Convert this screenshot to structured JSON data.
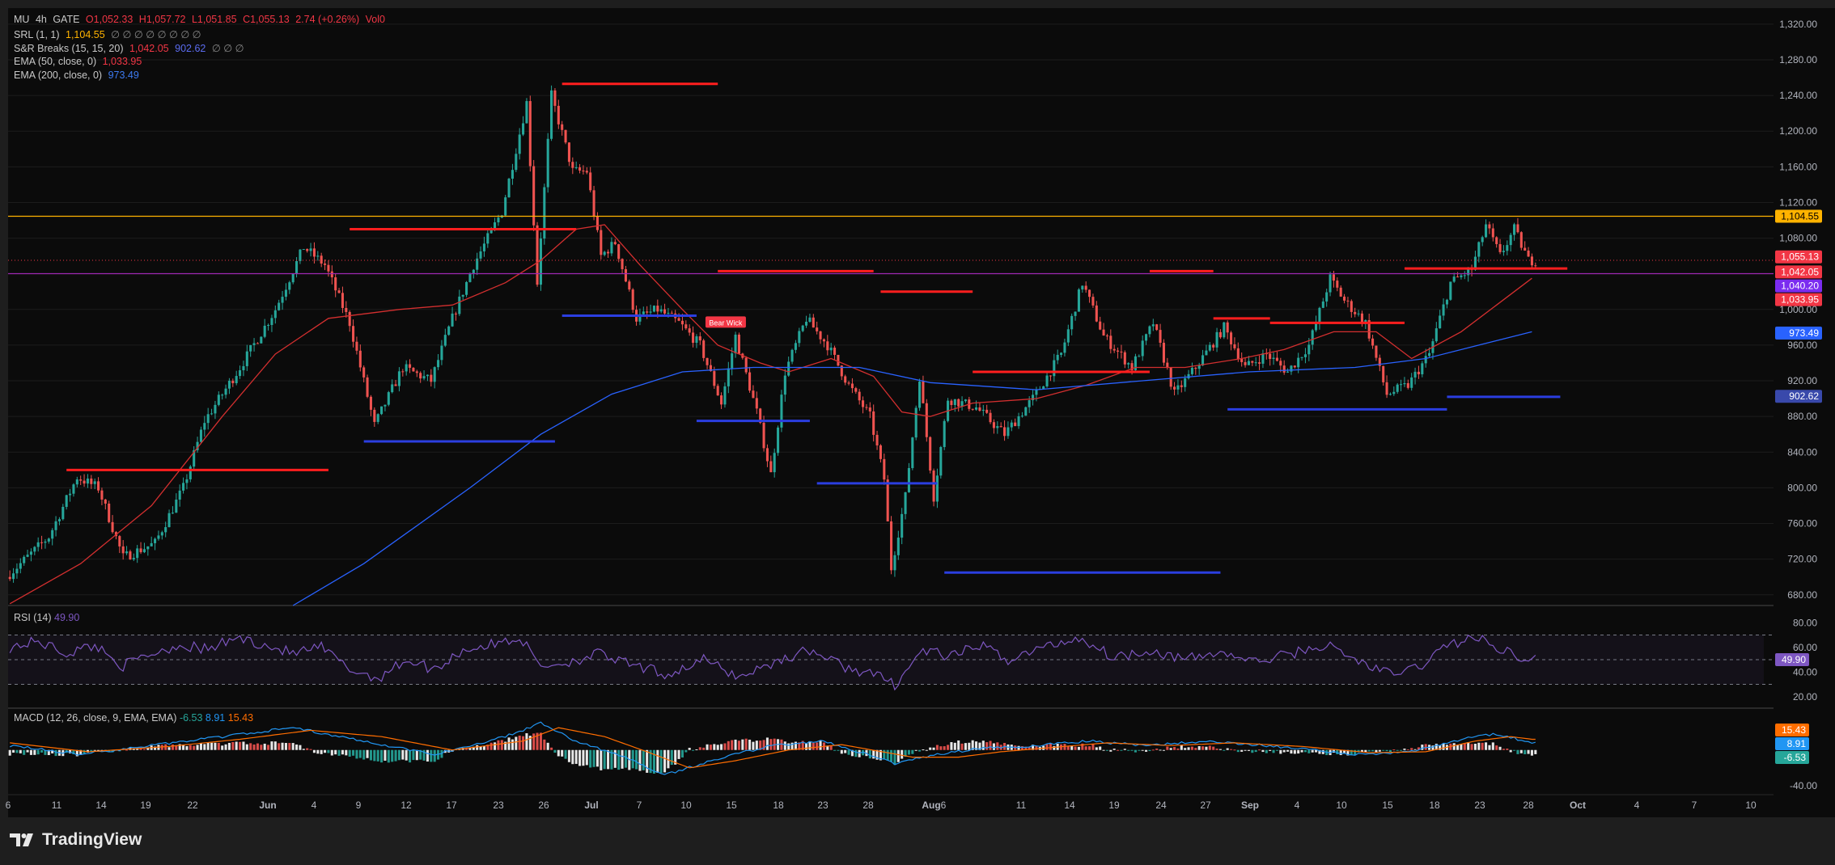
{
  "header": {
    "symbol": "MU",
    "interval": "4h",
    "exchange": "GATE",
    "open": "O1,052.33",
    "high": "H1,057.72",
    "low": "L1,051.85",
    "close": "C1,055.13",
    "change": "2.74 (+0.26%)",
    "volume": "Vol0"
  },
  "indicators": [
    {
      "name": "SRL (1, 1)",
      "v1": "1,104.55",
      "c1": "#ffb300",
      "v2": "",
      "c2": "",
      "v3": "1,040.20",
      "c3": "#b388ff",
      "tail": "∅ ∅ ∅ ∅ ∅ ∅ ∅ ∅"
    },
    {
      "name": "S&R Breaks (15, 15, 20)",
      "v1": "1,042.05",
      "c1": "#f23645",
      "v2": "",
      "c2": "",
      "v3": "902.62",
      "c3": "#5b6cf0",
      "tail": "∅ ∅ ∅"
    },
    {
      "name": "EMA (50, close, 0)",
      "v1": "1,033.95",
      "c1": "#f23645",
      "v2": "",
      "c2": "",
      "v3": "",
      "c3": "",
      "tail": ""
    },
    {
      "name": "EMA (200, close, 0)",
      "v1": "973.49",
      "c1": "#3d7af0",
      "v2": "",
      "c2": "",
      "v3": "",
      "c3": "",
      "tail": ""
    }
  ],
  "rsi_label": {
    "name": "RSI (14)",
    "value": "49.90"
  },
  "macd_label": {
    "name": "MACD (12, 26, close, 9, EMA, EMA)",
    "v1": "-6.53",
    "v2": "8.91",
    "v3": "15.43"
  },
  "brand": "TradingView",
  "colors": {
    "bull": "#26a69a",
    "bear": "#ef5350",
    "srl": "#ffb300",
    "resistance": "#ff1e1e",
    "support": "#2b3ee0",
    "ema50": "#d32f2f",
    "ema200": "#2962ff",
    "rsi": "#7e57c2",
    "macd": "#2196f3",
    "signal": "#ff6d00"
  },
  "chart_data": {
    "type": "candlestick",
    "price_axis_ticks": [
      "1,320.00",
      "1,280.00",
      "1,240.00",
      "1,200.00",
      "1,160.00",
      "1,120.00",
      "1,080.00",
      "1,040.00",
      "1,000.00",
      "960.00",
      "920.00",
      "880.00",
      "840.00",
      "800.00",
      "760.00",
      "720.00",
      "680.00"
    ],
    "ylim": [
      668,
      1338
    ],
    "time_axis_ticks": [
      "6",
      "11",
      "14",
      "19",
      "22",
      "Jun",
      "4",
      "9",
      "12",
      "17",
      "23",
      "26",
      "Jul",
      "7",
      "10",
      "15",
      "18",
      "23",
      "28",
      "Aug",
      "6",
      "11",
      "14",
      "19",
      "24",
      "27",
      "Sep",
      "4",
      "10",
      "15",
      "18",
      "23",
      "28",
      "Oct",
      "4",
      "7",
      "10"
    ],
    "bold_time_ticks": [
      "Jun",
      "Jul",
      "Aug",
      "Sep",
      "Oct"
    ],
    "trend_anchors": [
      {
        "i": 0,
        "p": 700
      },
      {
        "i": 12,
        "p": 745
      },
      {
        "i": 20,
        "p": 812
      },
      {
        "i": 26,
        "p": 800
      },
      {
        "i": 33,
        "p": 722
      },
      {
        "i": 42,
        "p": 738
      },
      {
        "i": 50,
        "p": 800
      },
      {
        "i": 56,
        "p": 875
      },
      {
        "i": 66,
        "p": 935
      },
      {
        "i": 76,
        "p": 1000
      },
      {
        "i": 84,
        "p": 1070
      },
      {
        "i": 90,
        "p": 1050
      },
      {
        "i": 97,
        "p": 985
      },
      {
        "i": 104,
        "p": 870
      },
      {
        "i": 112,
        "p": 935
      },
      {
        "i": 120,
        "p": 920
      },
      {
        "i": 126,
        "p": 990
      },
      {
        "i": 132,
        "p": 1050
      },
      {
        "i": 140,
        "p": 1110
      },
      {
        "i": 144,
        "p": 1180
      },
      {
        "i": 147,
        "p": 1232
      },
      {
        "i": 150,
        "p": 1030
      },
      {
        "i": 154,
        "p": 1240
      },
      {
        "i": 160,
        "p": 1155
      },
      {
        "i": 164,
        "p": 1155
      },
      {
        "i": 168,
        "p": 1060
      },
      {
        "i": 172,
        "p": 1075
      },
      {
        "i": 178,
        "p": 990
      },
      {
        "i": 184,
        "p": 1000
      },
      {
        "i": 190,
        "p": 985
      },
      {
        "i": 196,
        "p": 960
      },
      {
        "i": 202,
        "p": 895
      },
      {
        "i": 206,
        "p": 970
      },
      {
        "i": 212,
        "p": 885
      },
      {
        "i": 216,
        "p": 815
      },
      {
        "i": 220,
        "p": 930
      },
      {
        "i": 226,
        "p": 990
      },
      {
        "i": 232,
        "p": 960
      },
      {
        "i": 238,
        "p": 915
      },
      {
        "i": 244,
        "p": 880
      },
      {
        "i": 248,
        "p": 810
      },
      {
        "i": 250,
        "p": 710
      },
      {
        "i": 254,
        "p": 790
      },
      {
        "i": 258,
        "p": 925
      },
      {
        "i": 262,
        "p": 790
      },
      {
        "i": 266,
        "p": 900
      },
      {
        "i": 274,
        "p": 890
      },
      {
        "i": 282,
        "p": 860
      },
      {
        "i": 290,
        "p": 900
      },
      {
        "i": 298,
        "p": 950
      },
      {
        "i": 304,
        "p": 1030
      },
      {
        "i": 310,
        "p": 970
      },
      {
        "i": 318,
        "p": 935
      },
      {
        "i": 324,
        "p": 985
      },
      {
        "i": 330,
        "p": 905
      },
      {
        "i": 336,
        "p": 935
      },
      {
        "i": 344,
        "p": 980
      },
      {
        "i": 350,
        "p": 935
      },
      {
        "i": 356,
        "p": 950
      },
      {
        "i": 362,
        "p": 930
      },
      {
        "i": 368,
        "p": 960
      },
      {
        "i": 374,
        "p": 1035
      },
      {
        "i": 378,
        "p": 1010
      },
      {
        "i": 384,
        "p": 985
      },
      {
        "i": 390,
        "p": 905
      },
      {
        "i": 396,
        "p": 915
      },
      {
        "i": 402,
        "p": 950
      },
      {
        "i": 408,
        "p": 1030
      },
      {
        "i": 414,
        "p": 1045
      },
      {
        "i": 418,
        "p": 1095
      },
      {
        "i": 422,
        "p": 1060
      },
      {
        "i": 426,
        "p": 1090
      },
      {
        "i": 430,
        "p": 1055
      }
    ],
    "ema50_points": [
      [
        0,
        670
      ],
      [
        20,
        715
      ],
      [
        40,
        780
      ],
      [
        60,
        880
      ],
      [
        75,
        950
      ],
      [
        90,
        990
      ],
      [
        110,
        1000
      ],
      [
        125,
        1005
      ],
      [
        140,
        1030
      ],
      [
        150,
        1055
      ],
      [
        160,
        1090
      ],
      [
        168,
        1095
      ],
      [
        178,
        1050
      ],
      [
        190,
        1000
      ],
      [
        200,
        960
      ],
      [
        212,
        940
      ],
      [
        220,
        930
      ],
      [
        232,
        945
      ],
      [
        244,
        925
      ],
      [
        252,
        885
      ],
      [
        260,
        880
      ],
      [
        272,
        895
      ],
      [
        290,
        900
      ],
      [
        304,
        915
      ],
      [
        318,
        935
      ],
      [
        332,
        935
      ],
      [
        348,
        945
      ],
      [
        360,
        955
      ],
      [
        374,
        975
      ],
      [
        386,
        975
      ],
      [
        396,
        945
      ],
      [
        410,
        975
      ],
      [
        420,
        1005
      ],
      [
        430,
        1035
      ]
    ],
    "ema200_points": [
      [
        80,
        668
      ],
      [
        100,
        715
      ],
      [
        130,
        800
      ],
      [
        150,
        860
      ],
      [
        170,
        905
      ],
      [
        190,
        930
      ],
      [
        210,
        935
      ],
      [
        240,
        935
      ],
      [
        260,
        918
      ],
      [
        290,
        910
      ],
      [
        320,
        920
      ],
      [
        350,
        930
      ],
      [
        380,
        935
      ],
      [
        400,
        945
      ],
      [
        415,
        960
      ],
      [
        430,
        975
      ]
    ],
    "resistance_levels": [
      {
        "start": 16,
        "end": 90,
        "price": 820
      },
      {
        "start": 96,
        "end": 160,
        "price": 1090
      },
      {
        "start": 156,
        "end": 200,
        "price": 1253
      },
      {
        "start": 200,
        "end": 244,
        "price": 1043
      },
      {
        "start": 246,
        "end": 272,
        "price": 1020
      },
      {
        "start": 272,
        "end": 322,
        "price": 930
      },
      {
        "start": 322,
        "end": 340,
        "price": 1043
      },
      {
        "start": 340,
        "end": 356,
        "price": 990
      },
      {
        "start": 356,
        "end": 394,
        "price": 985
      },
      {
        "start": 394,
        "end": 440,
        "price": 1046
      }
    ],
    "support_levels": [
      {
        "start": 100,
        "end": 154,
        "price": 852
      },
      {
        "start": 156,
        "end": 194,
        "price": 993
      },
      {
        "start": 194,
        "end": 226,
        "price": 875
      },
      {
        "start": 228,
        "end": 262,
        "price": 805
      },
      {
        "start": 264,
        "end": 342,
        "price": 705
      },
      {
        "start": 344,
        "end": 406,
        "price": 888
      },
      {
        "start": 406,
        "end": 438,
        "price": 902
      }
    ],
    "srl_level": 1104.55,
    "srl2_level": 1040.2,
    "last_price": 1055.13,
    "markers": [
      {
        "i": 202,
        "price": 985,
        "text": "Bear Wick"
      }
    ],
    "price_badges": [
      {
        "price": 1104.55,
        "text": "1,104.55",
        "color": "#ffb300",
        "fg": "#000"
      },
      {
        "price": 1059.0,
        "text": "1,055.13",
        "color": "#f23645",
        "fg": "#fff"
      },
      {
        "price": 1042.05,
        "text": "1,042.05",
        "color": "#f23645",
        "fg": "#fff"
      },
      {
        "price": 1026.5,
        "text": "1,040.20",
        "color": "#7b2cf0",
        "fg": "#fff"
      },
      {
        "price": 1011.0,
        "text": "1,033.95",
        "color": "#f23645",
        "fg": "#fff"
      },
      {
        "price": 973.49,
        "text": "973.49",
        "color": "#2962ff",
        "fg": "#fff"
      },
      {
        "price": 902.62,
        "text": "902.62",
        "color": "#3949ab",
        "fg": "#fff"
      }
    ],
    "rsi": {
      "ticks": [
        "80.00",
        "60.00",
        "40.00",
        "20.00"
      ],
      "levels": [
        70,
        50,
        30
      ],
      "anchors": [
        [
          0,
          60
        ],
        [
          8,
          65
        ],
        [
          16,
          55
        ],
        [
          24,
          62
        ],
        [
          32,
          45
        ],
        [
          40,
          55
        ],
        [
          48,
          62
        ],
        [
          56,
          58
        ],
        [
          64,
          68
        ],
        [
          72,
          62
        ],
        [
          80,
          55
        ],
        [
          88,
          60
        ],
        [
          96,
          42
        ],
        [
          104,
          35
        ],
        [
          112,
          50
        ],
        [
          120,
          42
        ],
        [
          128,
          58
        ],
        [
          136,
          62
        ],
        [
          144,
          68
        ],
        [
          150,
          45
        ],
        [
          158,
          48
        ],
        [
          166,
          55
        ],
        [
          176,
          45
        ],
        [
          186,
          38
        ],
        [
          196,
          50
        ],
        [
          206,
          36
        ],
        [
          216,
          48
        ],
        [
          226,
          58
        ],
        [
          236,
          44
        ],
        [
          244,
          38
        ],
        [
          250,
          30
        ],
        [
          258,
          58
        ],
        [
          266,
          52
        ],
        [
          274,
          62
        ],
        [
          282,
          50
        ],
        [
          292,
          60
        ],
        [
          302,
          68
        ],
        [
          312,
          52
        ],
        [
          322,
          58
        ],
        [
          332,
          50
        ],
        [
          342,
          56
        ],
        [
          352,
          48
        ],
        [
          362,
          55
        ],
        [
          372,
          62
        ],
        [
          380,
          50
        ],
        [
          390,
          38
        ],
        [
          398,
          44
        ],
        [
          406,
          62
        ],
        [
          414,
          68
        ],
        [
          422,
          58
        ],
        [
          430,
          50
        ]
      ],
      "badge": "49.90"
    },
    "macd": {
      "ticks": [
        "-40.00"
      ],
      "macd_anchors": [
        [
          0,
          5
        ],
        [
          20,
          -5
        ],
        [
          40,
          5
        ],
        [
          60,
          15
        ],
        [
          80,
          25
        ],
        [
          100,
          10
        ],
        [
          120,
          -5
        ],
        [
          140,
          15
        ],
        [
          150,
          30
        ],
        [
          160,
          10
        ],
        [
          175,
          -10
        ],
        [
          185,
          -28
        ],
        [
          200,
          -10
        ],
        [
          215,
          5
        ],
        [
          230,
          10
        ],
        [
          250,
          -15
        ],
        [
          262,
          -5
        ],
        [
          275,
          2
        ],
        [
          290,
          5
        ],
        [
          305,
          10
        ],
        [
          320,
          5
        ],
        [
          340,
          10
        ],
        [
          360,
          3
        ],
        [
          380,
          -5
        ],
        [
          395,
          -2
        ],
        [
          410,
          12
        ],
        [
          420,
          18
        ],
        [
          430,
          8
        ]
      ],
      "signal_anchors": [
        [
          0,
          8
        ],
        [
          22,
          -2
        ],
        [
          45,
          4
        ],
        [
          65,
          12
        ],
        [
          85,
          22
        ],
        [
          105,
          15
        ],
        [
          125,
          0
        ],
        [
          145,
          10
        ],
        [
          155,
          25
        ],
        [
          168,
          15
        ],
        [
          180,
          -2
        ],
        [
          192,
          -20
        ],
        [
          205,
          -12
        ],
        [
          220,
          0
        ],
        [
          235,
          6
        ],
        [
          255,
          -8
        ],
        [
          268,
          -8
        ],
        [
          280,
          -2
        ],
        [
          295,
          3
        ],
        [
          310,
          8
        ],
        [
          328,
          5
        ],
        [
          346,
          8
        ],
        [
          365,
          4
        ],
        [
          384,
          -3
        ],
        [
          400,
          -2
        ],
        [
          414,
          10
        ],
        [
          424,
          15
        ],
        [
          430,
          12
        ]
      ],
      "badges": [
        {
          "text": "15.43",
          "color": "#ff6d00"
        },
        {
          "text": "8.91",
          "color": "#2196f3"
        },
        {
          "text": "-6.53",
          "color": "#26a69a"
        }
      ]
    }
  }
}
